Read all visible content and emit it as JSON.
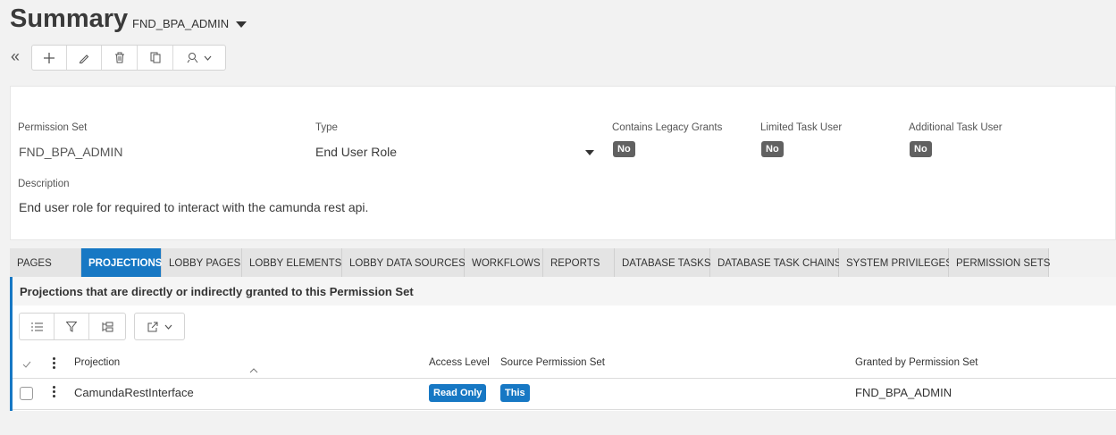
{
  "header": {
    "title": "Summary",
    "context": "FND_BPA_ADMIN"
  },
  "toolbar": {
    "icons": [
      "collapse-icon",
      "add-icon",
      "edit-icon",
      "delete-icon",
      "copy-icon",
      "actions-icon"
    ]
  },
  "form": {
    "permission_set_label": "Permission Set",
    "permission_set_value": "FND_BPA_ADMIN",
    "type_label": "Type",
    "type_value": "End User Role",
    "legacy_label": "Contains Legacy Grants",
    "legacy_value": "No",
    "limited_label": "Limited Task User",
    "limited_value": "No",
    "additional_label": "Additional Task User",
    "additional_value": "No",
    "description_label": "Description",
    "description_value": "End user role for required to interact with the camunda rest api."
  },
  "tabs": [
    "Pages",
    "Projections",
    "Lobby Pages",
    "Lobby Elements",
    "Lobby Data Sources",
    "Workflows",
    "Reports",
    "Database Tasks",
    "Database Task Chains",
    "System Privileges",
    "Permission Sets"
  ],
  "active_tab": "Projections",
  "grid": {
    "title": "Projections that are directly or indirectly granted to this Permission Set",
    "columns": [
      "Projection",
      "Access Level",
      "Source Permission Set",
      "Granted by Permission Set"
    ],
    "rows": [
      {
        "projection": "CamundaRestInterface",
        "access_level": "Read Only",
        "source": "This",
        "granted_by": "FND_BPA_ADMIN"
      }
    ]
  },
  "colors": {
    "accent": "#1778c4",
    "badge_gray": "#616161"
  }
}
